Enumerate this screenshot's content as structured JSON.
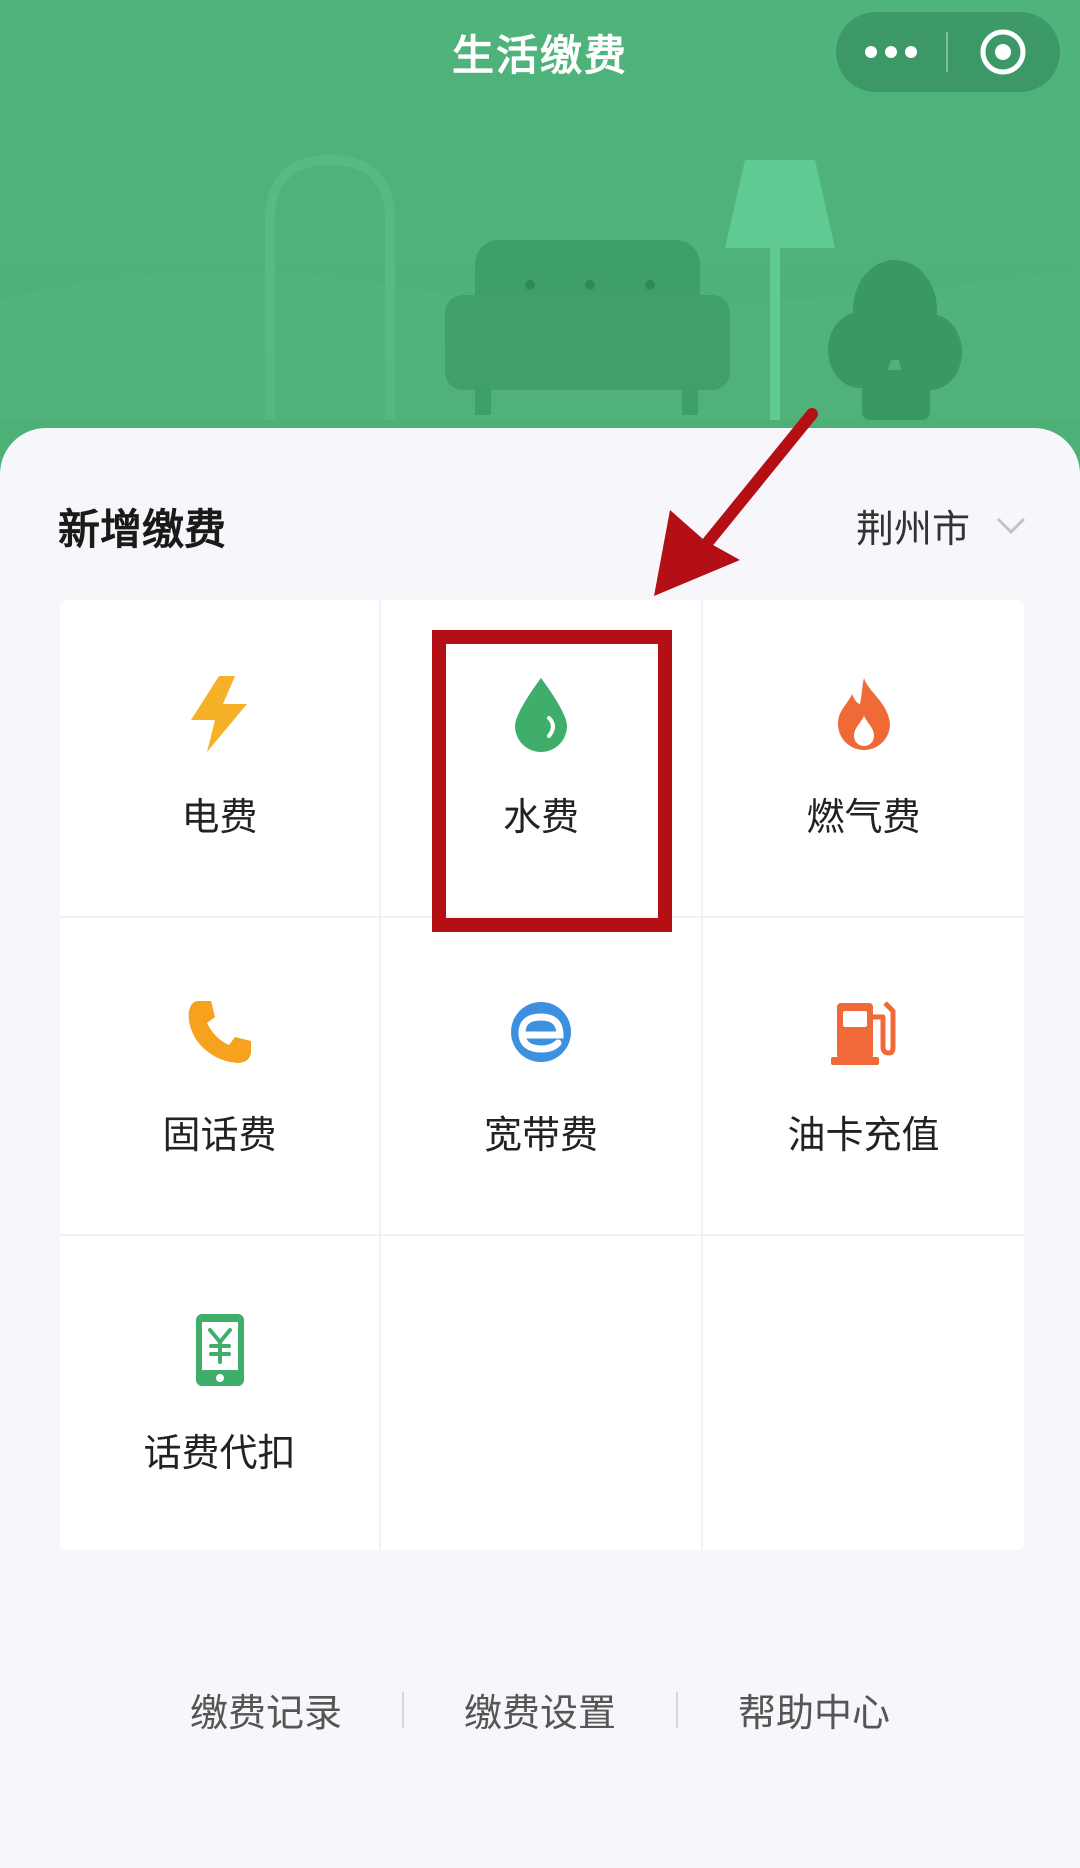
{
  "header": {
    "title": "生活缴费",
    "capsule": {
      "more_icon": "more-dots-icon",
      "close_icon": "target-circle-icon"
    }
  },
  "section": {
    "title": "新增缴费",
    "city": "荆州市",
    "city_icon": "chevron-down-icon"
  },
  "services": [
    {
      "label": "电费",
      "icon": "lightning-icon",
      "color": "#f7b128"
    },
    {
      "label": "水费",
      "icon": "water-drop-icon",
      "color": "#3fae6a"
    },
    {
      "label": "燃气费",
      "icon": "flame-icon",
      "color": "#f06a38"
    },
    {
      "label": "固话费",
      "icon": "phone-icon",
      "color": "#f7a21e"
    },
    {
      "label": "宽带费",
      "icon": "broadband-e-icon",
      "color": "#3d8fe0"
    },
    {
      "label": "油卡充值",
      "icon": "fuel-pump-icon",
      "color": "#f06a38"
    },
    {
      "label": "话费代扣",
      "icon": "mobile-yuan-icon",
      "color": "#3fae6a"
    }
  ],
  "footer": {
    "links": [
      "缴费记录",
      "缴费设置",
      "帮助中心"
    ]
  },
  "colors": {
    "header_green": "#4fb47c",
    "annotation_red": "#b50f16"
  }
}
